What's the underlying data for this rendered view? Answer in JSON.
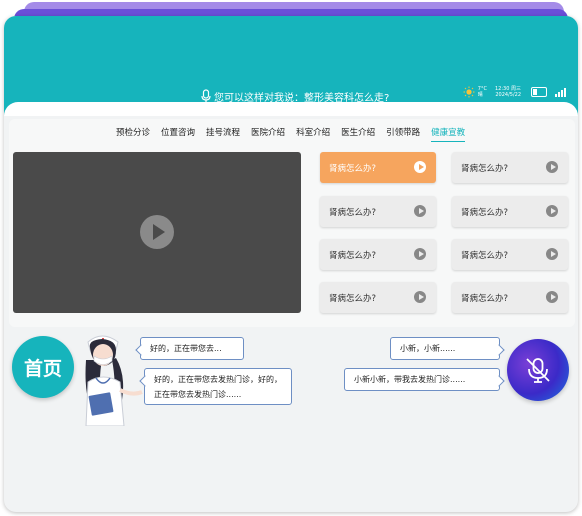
{
  "header": {
    "voice_prompt": "您可以这样对我说：整形美容科怎么走?",
    "weather": {
      "temperature": "7°C",
      "condition": "晴"
    },
    "clock": {
      "time": "12:30",
      "weekday": "周三",
      "date": "2024/5/22"
    }
  },
  "tabs": [
    {
      "label": "预检分诊"
    },
    {
      "label": "位置咨询"
    },
    {
      "label": "挂号流程"
    },
    {
      "label": "医院介绍"
    },
    {
      "label": "科室介绍"
    },
    {
      "label": "医生介绍"
    },
    {
      "label": "引领带路"
    },
    {
      "label": "健康宣教",
      "active": true
    }
  ],
  "videos": [
    {
      "label": "肾病怎么办?",
      "active": true
    },
    {
      "label": "肾病怎么办?"
    },
    {
      "label": "肾病怎么办?"
    },
    {
      "label": "肾病怎么办?"
    },
    {
      "label": "肾病怎么办?"
    },
    {
      "label": "肾病怎么办?"
    },
    {
      "label": "肾病怎么办?"
    },
    {
      "label": "肾病怎么办?"
    }
  ],
  "home_button": {
    "label": "首页"
  },
  "chat": {
    "robot_1": "好的，正在带您去...",
    "robot_2": "好的，正在带您去发热门诊，好的，正在带您去发热门诊......",
    "user_1": "小新，小新......",
    "user_2": "小新小新，带我去发热门诊......"
  },
  "colors": {
    "accent": "#16b4bc",
    "active_video": "#f6a55e",
    "mic_button": "#3b2ac8"
  }
}
